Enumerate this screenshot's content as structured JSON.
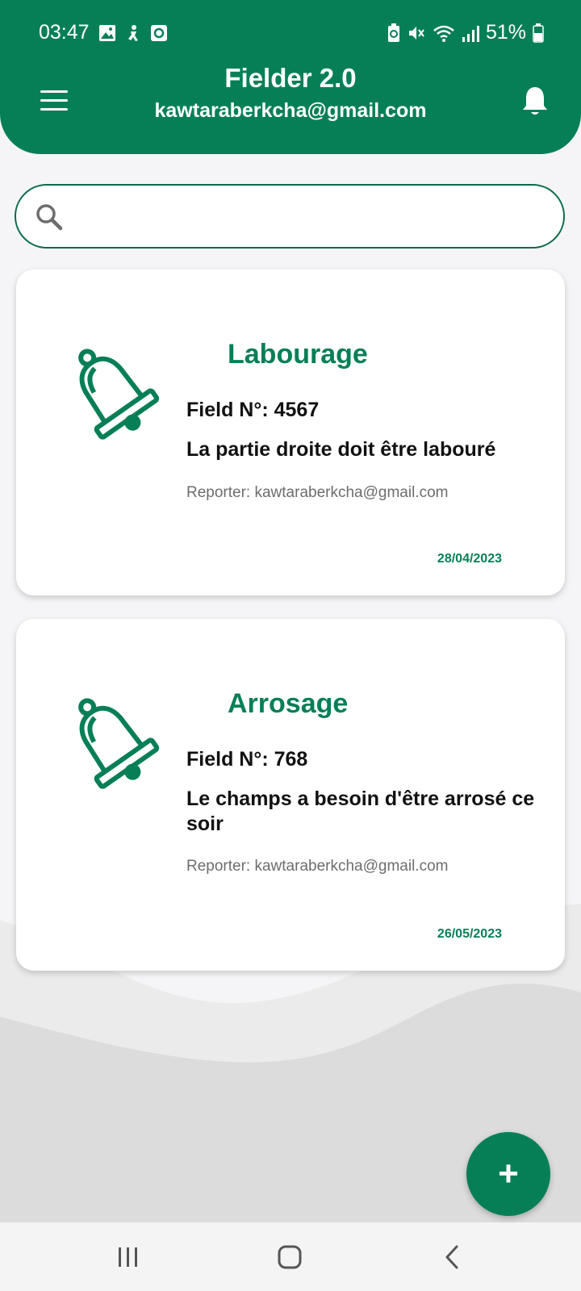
{
  "status_bar": {
    "time": "03:47",
    "battery": "51%",
    "left_icons": [
      "image-icon",
      "accessibility-icon",
      "record-icon"
    ],
    "right_icons": [
      "battery-saver-icon",
      "mute-icon",
      "wifi-icon",
      "signal-icon",
      "battery-icon"
    ]
  },
  "header": {
    "title": "Fielder 2.0",
    "subtitle": "kawtaraberkcha@gmail.com",
    "menu_icon": "menu-icon",
    "bell_icon": "bell-icon"
  },
  "search": {
    "placeholder": "",
    "value": ""
  },
  "cards": [
    {
      "title": "Labourage",
      "field": "Field N°: 4567",
      "description": "La partie droite doit être labouré",
      "reporter": "Reporter: kawtaraberkcha@gmail.com",
      "date": "28/04/2023",
      "icon": "bell-outline-icon"
    },
    {
      "title": "Arrosage",
      "field": "Field N°: 768",
      "description": "Le champs a besoin d'être arrosé ce soir",
      "reporter": "Reporter: kawtaraberkcha@gmail.com",
      "date": "26/05/2023",
      "icon": "bell-outline-icon"
    }
  ],
  "fab": {
    "label": "+"
  },
  "colors": {
    "primary": "#077f56",
    "background": "#f5f5f7",
    "card": "#ffffff",
    "secondary_text": "#6d6d6d"
  }
}
